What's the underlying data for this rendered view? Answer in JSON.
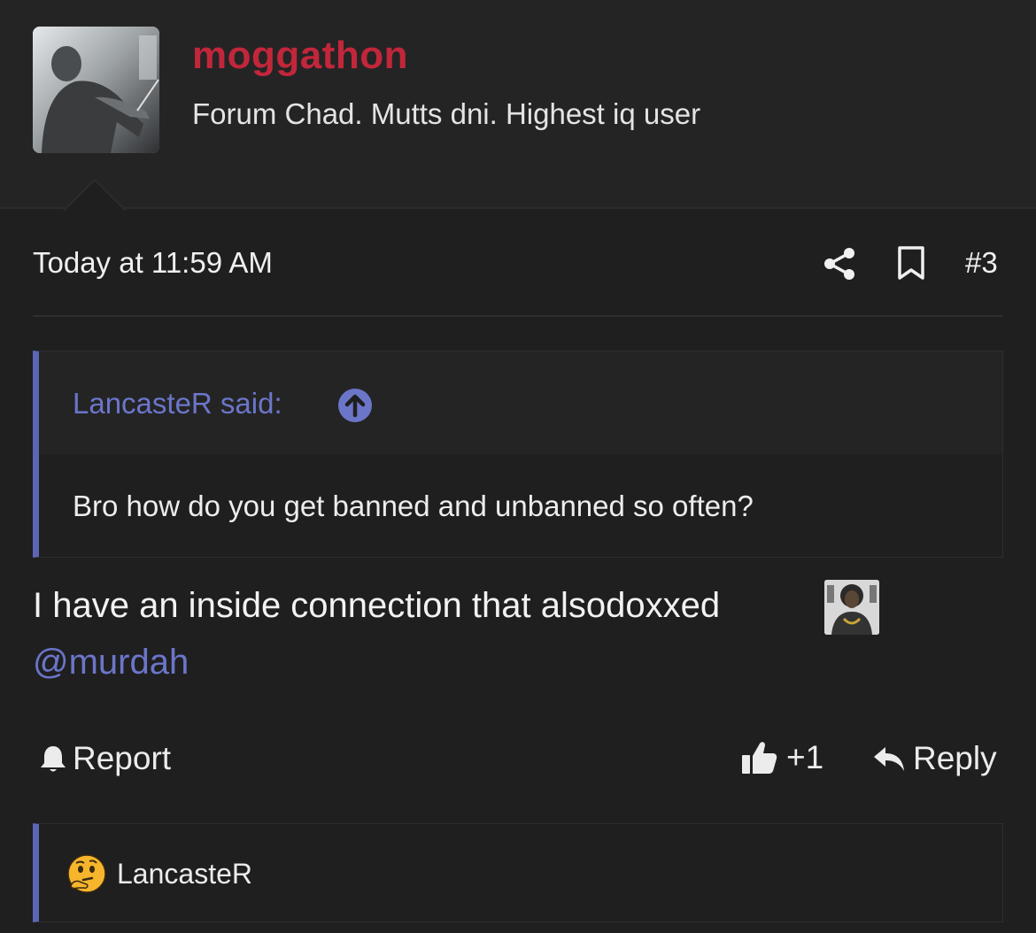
{
  "user": {
    "name": "moggathon",
    "title": "Forum Chad. Mutts dni. Highest iq user"
  },
  "post": {
    "date": "Today at 11:59 AM",
    "number": "#3"
  },
  "quote": {
    "author": "LancasteR said:",
    "text": "Bro how do you get banned and unbanned so often?"
  },
  "message": {
    "text": "I have an inside connection that alsodoxxed",
    "mention": "@murdah"
  },
  "actions": {
    "report_label": "Report",
    "like_label": "+1",
    "reply_label": "Reply"
  },
  "reactions": {
    "user": "LancasteR",
    "emoji": "thinking-face"
  },
  "colors": {
    "username": "#c2263a",
    "accent": "#6b76c9",
    "background": "#1f1f20"
  }
}
